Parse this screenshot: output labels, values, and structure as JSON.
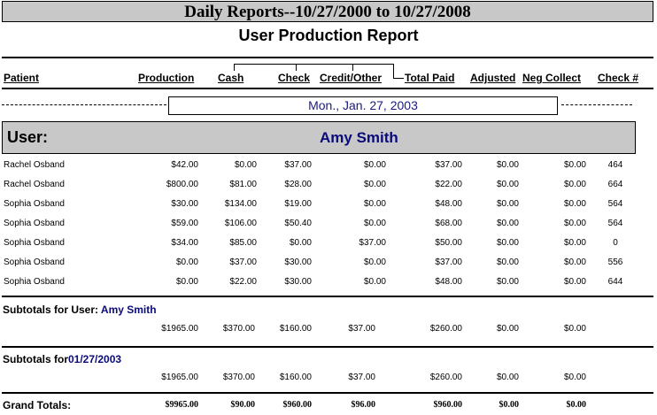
{
  "report": {
    "title": "Daily Reports--10/27/2000 to 10/27/2008",
    "subtitle": "User Production Report"
  },
  "columns": {
    "patient": "Patient",
    "production": "Production",
    "cash": "Cash",
    "check": "Check",
    "credit_other": "Credit/Other",
    "total_paid": "Total Paid",
    "adjusted": "Adjusted",
    "neg_collect": "Neg Collect",
    "check_num": "Check #"
  },
  "date_header": "Mon., Jan. 27, 2003",
  "user": {
    "label": "User:",
    "name": "Amy Smith"
  },
  "rows": [
    {
      "patient": "Rachel Osband",
      "production": "$42.00",
      "cash": "$0.00",
      "check": "$37.00",
      "credit": "$0.00",
      "total_paid": "$37.00",
      "adjusted": "$0.00",
      "neg_collect": "$0.00",
      "check_num": "464"
    },
    {
      "patient": "Rachel Osband",
      "production": "$800.00",
      "cash": "$81.00",
      "check": "$28.00",
      "credit": "$0.00",
      "total_paid": "$22.00",
      "adjusted": "$0.00",
      "neg_collect": "$0.00",
      "check_num": "664"
    },
    {
      "patient": "Sophia Osband",
      "production": "$30.00",
      "cash": "$134.00",
      "check": "$19.00",
      "credit": "$0.00",
      "total_paid": "$48.00",
      "adjusted": "$0.00",
      "neg_collect": "$0.00",
      "check_num": "564"
    },
    {
      "patient": "Sophia Osband",
      "production": "$59.00",
      "cash": "$106.00",
      "check": "$50.40",
      "credit": "$0.00",
      "total_paid": "$68.00",
      "adjusted": "$0.00",
      "neg_collect": "$0.00",
      "check_num": "564"
    },
    {
      "patient": "Sophia Osband",
      "production": "$34.00",
      "cash": "$85.00",
      "check": "$0.00",
      "credit": "$37.00",
      "total_paid": "$50.00",
      "adjusted": "$0.00",
      "neg_collect": "$0.00",
      "check_num": "0"
    },
    {
      "patient": "Sophia Osband",
      "production": "$0.00",
      "cash": "$37.00",
      "check": "$30.00",
      "credit": "$0.00",
      "total_paid": "$37.00",
      "adjusted": "$0.00",
      "neg_collect": "$0.00",
      "check_num": "556"
    },
    {
      "patient": "Sophia Osband",
      "production": "$0.00",
      "cash": "$22.00",
      "check": "$30.00",
      "credit": "$0.00",
      "total_paid": "$48.00",
      "adjusted": "$0.00",
      "neg_collect": "$0.00",
      "check_num": "644"
    }
  ],
  "subtotal_user": {
    "label": "Subtotals for User:",
    "name": "Amy Smith",
    "production": "$1965.00",
    "cash": "$370.00",
    "check": "$160.00",
    "credit": "$37.00",
    "total_paid": "$260.00",
    "adjusted": "$0.00",
    "neg_collect": "$0.00"
  },
  "subtotal_date": {
    "label": "Subtotals for",
    "date": "01/27/2003",
    "production": "$1965.00",
    "cash": "$370.00",
    "check": "$160.00",
    "credit": "$37.00",
    "total_paid": "$260.00",
    "adjusted": "$0.00",
    "neg_collect": "$0.00"
  },
  "grand_totals": {
    "label": "Grand Totals:",
    "production": "$9965.00",
    "cash": "$90.00",
    "check": "$960.00",
    "credit": "$96.00",
    "total_paid": "$960.00",
    "adjusted": "$0.00",
    "neg_collect": "$0.00"
  }
}
